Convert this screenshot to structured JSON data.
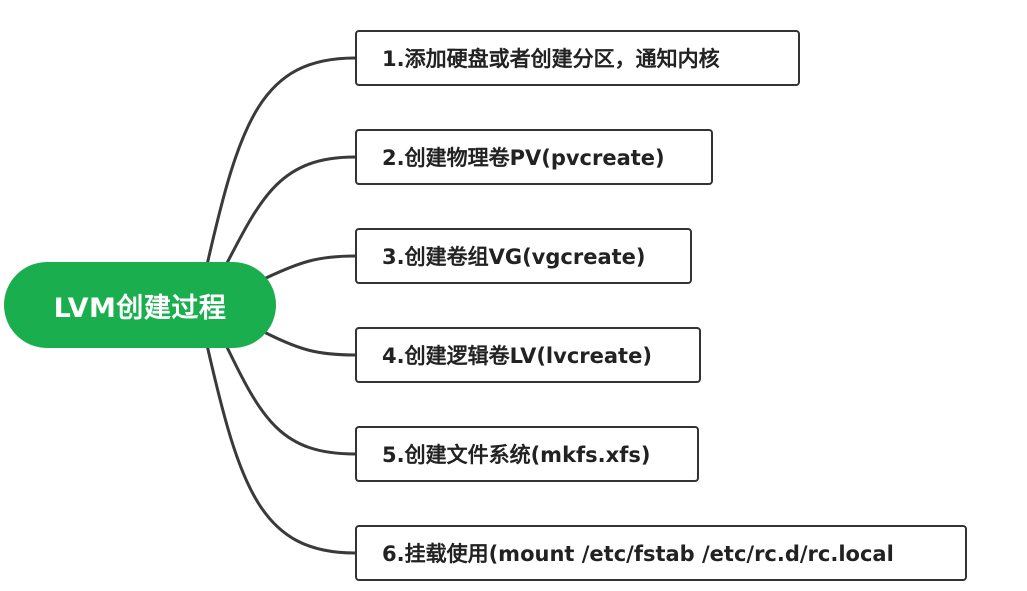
{
  "diagram": {
    "root": {
      "label": "LVM创建过程",
      "color": "#1aae4f"
    },
    "steps": [
      {
        "label": "1.添加硬盘或者创建分区，通知内核"
      },
      {
        "label": "2.创建物理卷PV(pvcreate)"
      },
      {
        "label": "3.创建卷组VG(vgcreate)"
      },
      {
        "label": "4.创建逻辑卷LV(lvcreate)"
      },
      {
        "label": "5.创建文件系统(mkfs.xfs)"
      },
      {
        "label": "6.挂载使用(mount /etc/fstab /etc/rc.d/rc.local"
      }
    ],
    "connector_color": "#3a3a3a",
    "box_border_color": "#333333"
  }
}
